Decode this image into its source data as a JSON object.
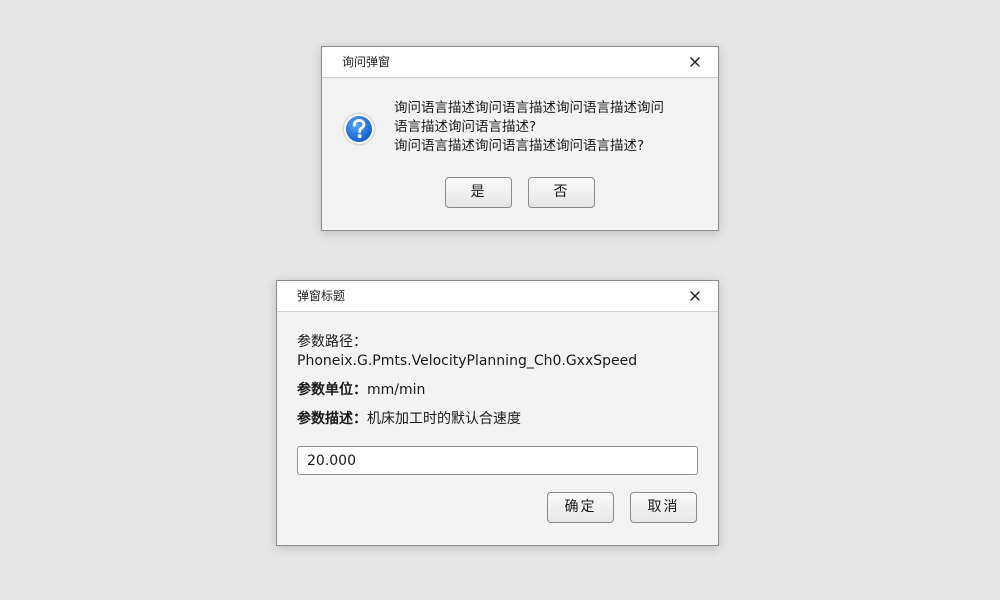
{
  "confirm_dialog": {
    "title": "询问弹窗",
    "icon": "question-icon",
    "message_lines": [
      "询问语言描述询问语言描述询问语言描述询问",
      "语言描述询问语言描述?",
      "询问语言描述询问语言描述询问语言描述?"
    ],
    "yes_label": "是",
    "no_label": "否"
  },
  "param_dialog": {
    "title": "弹窗标题",
    "path_label": "参数路径：",
    "path_value": "Phoneix.G.Pmts.VelocityPlanning_Ch0.GxxSpeed",
    "unit_label": "参数单位：",
    "unit_value": "mm/min",
    "desc_label": "参数描述：",
    "desc_value": "机床加工时的默认合速度",
    "input_value": "20.000",
    "ok_label": "确定",
    "cancel_label": "取消"
  },
  "colors": {
    "background": "#e6e6e6",
    "dialog_body": "#f3f3f3",
    "titlebar": "#ffffff",
    "question_icon": "#1e6fd9"
  }
}
